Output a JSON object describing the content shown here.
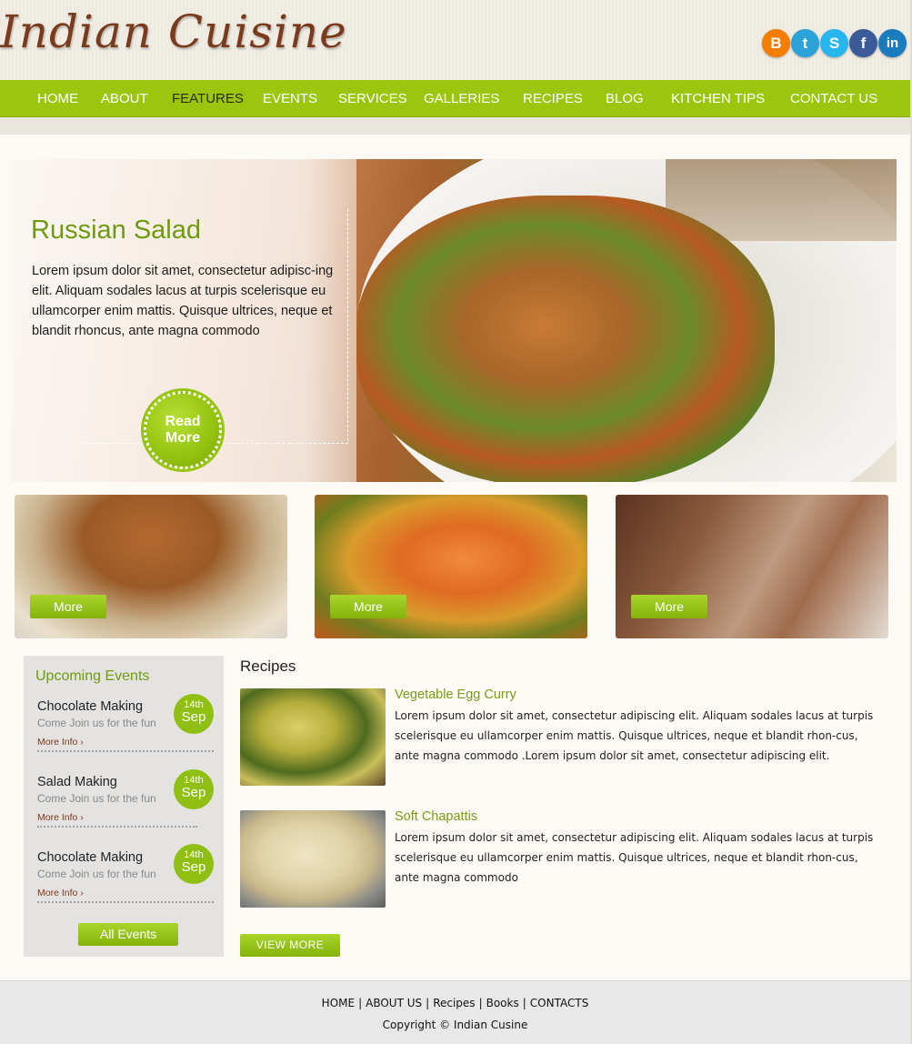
{
  "site": {
    "logo_text": "Indian Cuisine"
  },
  "social": [
    {
      "icon": "blogger-icon",
      "glyph": "B",
      "color": "#f57d00"
    },
    {
      "icon": "twitter-icon",
      "glyph": "t",
      "color": "#2ba3d8"
    },
    {
      "icon": "skype-icon",
      "glyph": "S",
      "color": "#27b6ef"
    },
    {
      "icon": "facebook-icon",
      "glyph": "f",
      "color": "#3b5b98"
    },
    {
      "icon": "linkedin-icon",
      "glyph": "in",
      "color": "#1a7bbd"
    }
  ],
  "nav": {
    "items": [
      "HOME",
      "ABOUT",
      "FEATURES",
      "EVENTS",
      "SERVICES",
      "GALLERIES",
      "RECIPES",
      "BLOG",
      "KITCHEN TIPS",
      "CONTACT US"
    ],
    "active": "FEATURES"
  },
  "hero": {
    "title": "Russian Salad",
    "text": "Lorem ipsum dolor sit amet, consectetur adipisc-ing elit. Aliquam sodales lacus at turpis scelerisque eu ullamcorper enim mattis. Quisque ultrices, neque et blandit rhoncus, ante magna commodo",
    "button_line1": "Read",
    "button_line2": "More"
  },
  "thumbnails": [
    {
      "label": "More"
    },
    {
      "label": "More"
    },
    {
      "label": "More"
    }
  ],
  "events": {
    "title": "Upcoming Events",
    "items": [
      {
        "name": "Chocolate Making",
        "sub": "Come Join us for the fun",
        "more": "More Info ›",
        "day": "14th",
        "month": "Sep"
      },
      {
        "name": "Salad Making",
        "sub": "Come Join us for the fun",
        "more": "More Info ›",
        "day": "14th",
        "month": "Sep"
      },
      {
        "name": "Chocolate Making",
        "sub": "Come Join us for the fun",
        "more": "More Info ›",
        "day": "14th",
        "month": "Sep"
      }
    ],
    "all_label": "All Events"
  },
  "recipes": {
    "title": "Recipes",
    "items": [
      {
        "title": "Vegetable Egg Curry",
        "text": "Lorem ipsum dolor sit amet, consectetur adipiscing elit. Aliquam sodales lacus at turpis scelerisque eu ullamcorper enim mattis. Quisque ultrices, neque et blandit rhon-cus, ante magna commodo .Lorem ipsum dolor sit amet, consectetur adipiscing elit."
      },
      {
        "title": "Soft Chapattis",
        "text": "Lorem ipsum dolor sit amet, consectetur adipiscing elit. Aliquam sodales lacus at turpis scelerisque eu ullamcorper enim mattis. Quisque ultrices, neque et blandit rhon-cus, ante magna commodo"
      }
    ],
    "view_more": "VIEW MORE"
  },
  "footer": {
    "links": [
      "HOME",
      "ABOUT US",
      "Recipes",
      "Books",
      "CONTACTS"
    ],
    "separator": "|",
    "copyright": "Copyright © Indian Cusine"
  },
  "colors": {
    "accent": "#9cc60d",
    "brand": "#7a3a1c",
    "title_green": "#6f9a10"
  }
}
